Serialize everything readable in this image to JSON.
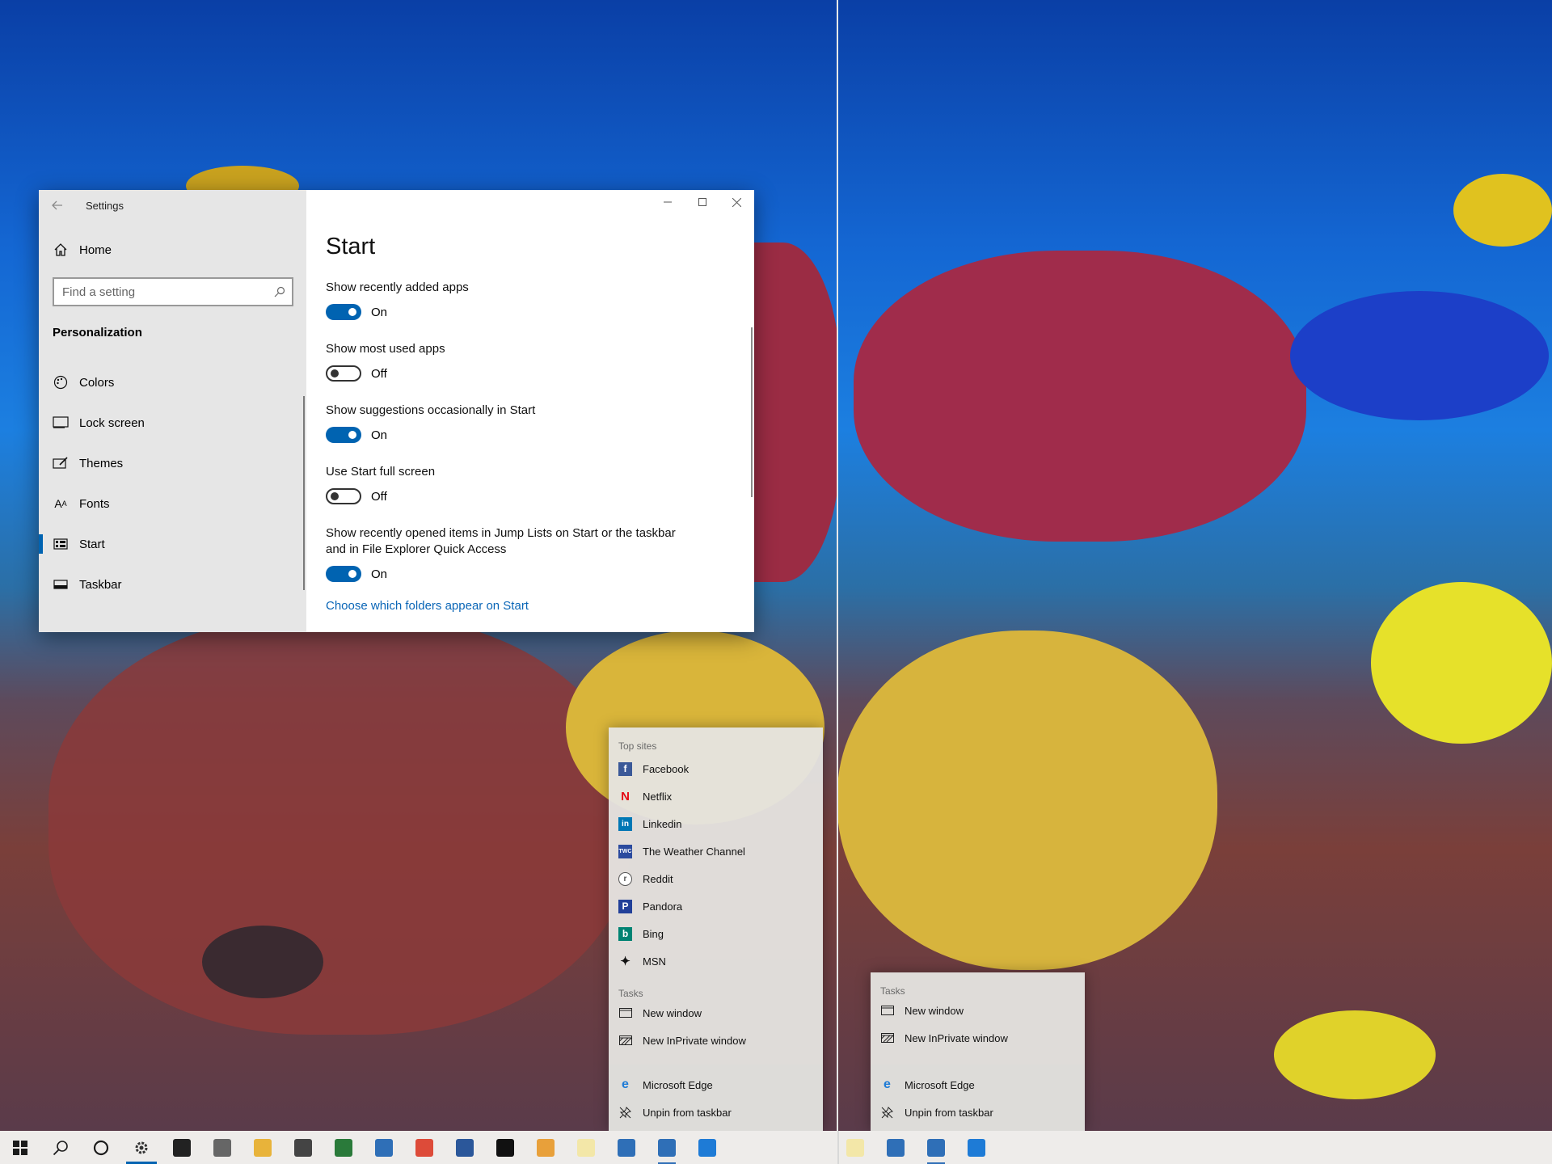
{
  "settings": {
    "window_title": "Settings",
    "home_label": "Home",
    "search_placeholder": "Find a setting",
    "section": "Personalization",
    "nav_items": [
      {
        "label": "Colors",
        "icon": "palette-icon"
      },
      {
        "label": "Lock screen",
        "icon": "lock-screen-icon"
      },
      {
        "label": "Themes",
        "icon": "themes-icon"
      },
      {
        "label": "Fonts",
        "icon": "fonts-icon"
      },
      {
        "label": "Start",
        "icon": "start-menu-icon",
        "active": true
      },
      {
        "label": "Taskbar",
        "icon": "taskbar-icon"
      }
    ],
    "page_title": "Start",
    "options": [
      {
        "label": "Show recently added apps",
        "state": "On"
      },
      {
        "label": "Show most used apps",
        "state": "Off"
      },
      {
        "label": "Show suggestions occasionally in Start",
        "state": "On"
      },
      {
        "label": "Use Start full screen",
        "state": "Off"
      },
      {
        "label": "Show recently opened items in Jump Lists on Start or the taskbar and in File Explorer Quick Access",
        "state": "On"
      }
    ],
    "link": "Choose which folders appear on Start",
    "accent_color": "#0063b1"
  },
  "jumplist_left": {
    "top_sites_header": "Top sites",
    "top_sites": [
      {
        "label": "Facebook",
        "icon": "facebook-icon",
        "color": "#3b5998",
        "glyph": "f"
      },
      {
        "label": "Netflix",
        "icon": "netflix-icon",
        "color": "#e50914",
        "glyph": "N"
      },
      {
        "label": "Linkedin",
        "icon": "linkedin-icon",
        "color": "#0077b5",
        "glyph": "in"
      },
      {
        "label": "The Weather Channel",
        "icon": "weather-channel-icon",
        "color": "#2b4a9e",
        "glyph": "T"
      },
      {
        "label": "Reddit",
        "icon": "reddit-icon",
        "color": "#ffffff",
        "glyph": "r"
      },
      {
        "label": "Pandora",
        "icon": "pandora-icon",
        "color": "#224099",
        "glyph": "P"
      },
      {
        "label": "Bing",
        "icon": "bing-icon",
        "color": "#008373",
        "glyph": "b"
      },
      {
        "label": "MSN",
        "icon": "msn-icon",
        "color": "#ffffff",
        "glyph": "M"
      }
    ],
    "tasks_header": "Tasks",
    "tasks": [
      {
        "label": "New window",
        "icon": "new-window-icon"
      },
      {
        "label": "New InPrivate window",
        "icon": "inprivate-window-icon"
      }
    ],
    "pinned": [
      {
        "label": "Microsoft Edge",
        "icon": "edge-icon"
      },
      {
        "label": "Unpin from taskbar",
        "icon": "unpin-icon"
      }
    ]
  },
  "jumplist_right": {
    "tasks_header": "Tasks",
    "tasks": [
      {
        "label": "New window",
        "icon": "new-window-icon"
      },
      {
        "label": "New InPrivate window",
        "icon": "inprivate-window-icon"
      }
    ],
    "pinned": [
      {
        "label": "Microsoft Edge",
        "icon": "edge-icon"
      },
      {
        "label": "Unpin from taskbar",
        "icon": "unpin-icon"
      }
    ]
  },
  "taskbar": {
    "left_icons": [
      {
        "name": "start-icon",
        "color": "#1b1b1b"
      },
      {
        "name": "search-icon",
        "color": "#1b1b1b"
      },
      {
        "name": "cortana-icon",
        "color": "#1b1b1b"
      },
      {
        "name": "settings-gear-icon",
        "color": "#333333",
        "active": true
      },
      {
        "name": "store-icon",
        "color": "#222222"
      },
      {
        "name": "camera-icon",
        "color": "#666666"
      },
      {
        "name": "file-explorer-icon",
        "color": "#e8b33a"
      },
      {
        "name": "mail-icon",
        "color": "#444444"
      },
      {
        "name": "edge-beta-icon",
        "color": "#2a7a3a"
      },
      {
        "name": "app-icon",
        "color": "#2f6fb7"
      },
      {
        "name": "chrome-icon",
        "color": "#dd4b39"
      },
      {
        "name": "word-icon",
        "color": "#2b579a"
      },
      {
        "name": "terminal-icon",
        "color": "#111111"
      },
      {
        "name": "app-orange-icon",
        "color": "#e8a03a"
      },
      {
        "name": "notepad-icon",
        "color": "#f3e7a8"
      },
      {
        "name": "powershell-icon",
        "color": "#2f6fb7"
      },
      {
        "name": "edge-canary-icon",
        "color": "#2f6fb7",
        "running": true
      },
      {
        "name": "edge-icon",
        "color": "#1e7bd6"
      }
    ],
    "right_icons": [
      {
        "name": "notepad-icon",
        "color": "#f3e7a8"
      },
      {
        "name": "powershell-icon",
        "color": "#2f6fb7"
      },
      {
        "name": "edge-canary-icon",
        "color": "#2f6fb7",
        "running": true
      },
      {
        "name": "edge-icon",
        "color": "#1e7bd6"
      }
    ]
  }
}
